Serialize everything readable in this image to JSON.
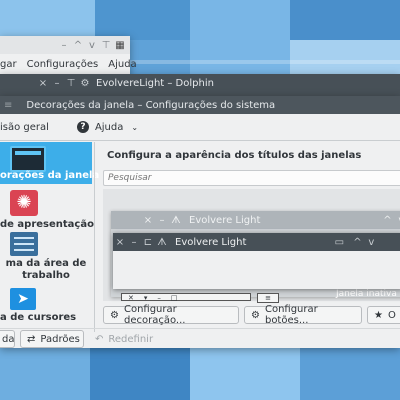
{
  "colors": {
    "desktop": "#5fa2d8",
    "titlebar_dark": "#475057",
    "accent": "#3daee9",
    "window_bg": "#eff0f1"
  },
  "back_window": {
    "menu": [
      "gar",
      "Configurações",
      "Ajuda"
    ]
  },
  "dolphin": {
    "title": "EvolvereLight – Dolphin"
  },
  "settings": {
    "title": "Decorações da janela – Configurações do sistema",
    "toolbar": {
      "overview_label": "isão geral",
      "help_label": "Ajuda"
    },
    "sidebar": [
      {
        "label": "orações da janela",
        "icon": "window-decoration-icon",
        "selected": true
      },
      {
        "label": "de apresentação",
        "icon": "splash-icon",
        "selected": false
      },
      {
        "label": "ma da área de trabalho",
        "icon": "desktop-theme-icon",
        "selected": false
      },
      {
        "label": "a de cursores",
        "icon": "cursor-icon",
        "selected": false
      }
    ],
    "heading": "Configura a aparência dos títulos das janelas",
    "search_placeholder": "Pesquisar",
    "preview": {
      "active_title": "Evolvere Light",
      "back_title": "Evolvere Light",
      "inactive_label": "Janela inativa"
    },
    "buttons": {
      "configure_decoration": "Configurar decoração...",
      "configure_buttons": "Configurar botões...",
      "third": "O"
    },
    "bottom": {
      "help": "da",
      "defaults": "Padrões",
      "reset": "Redefinir"
    }
  }
}
